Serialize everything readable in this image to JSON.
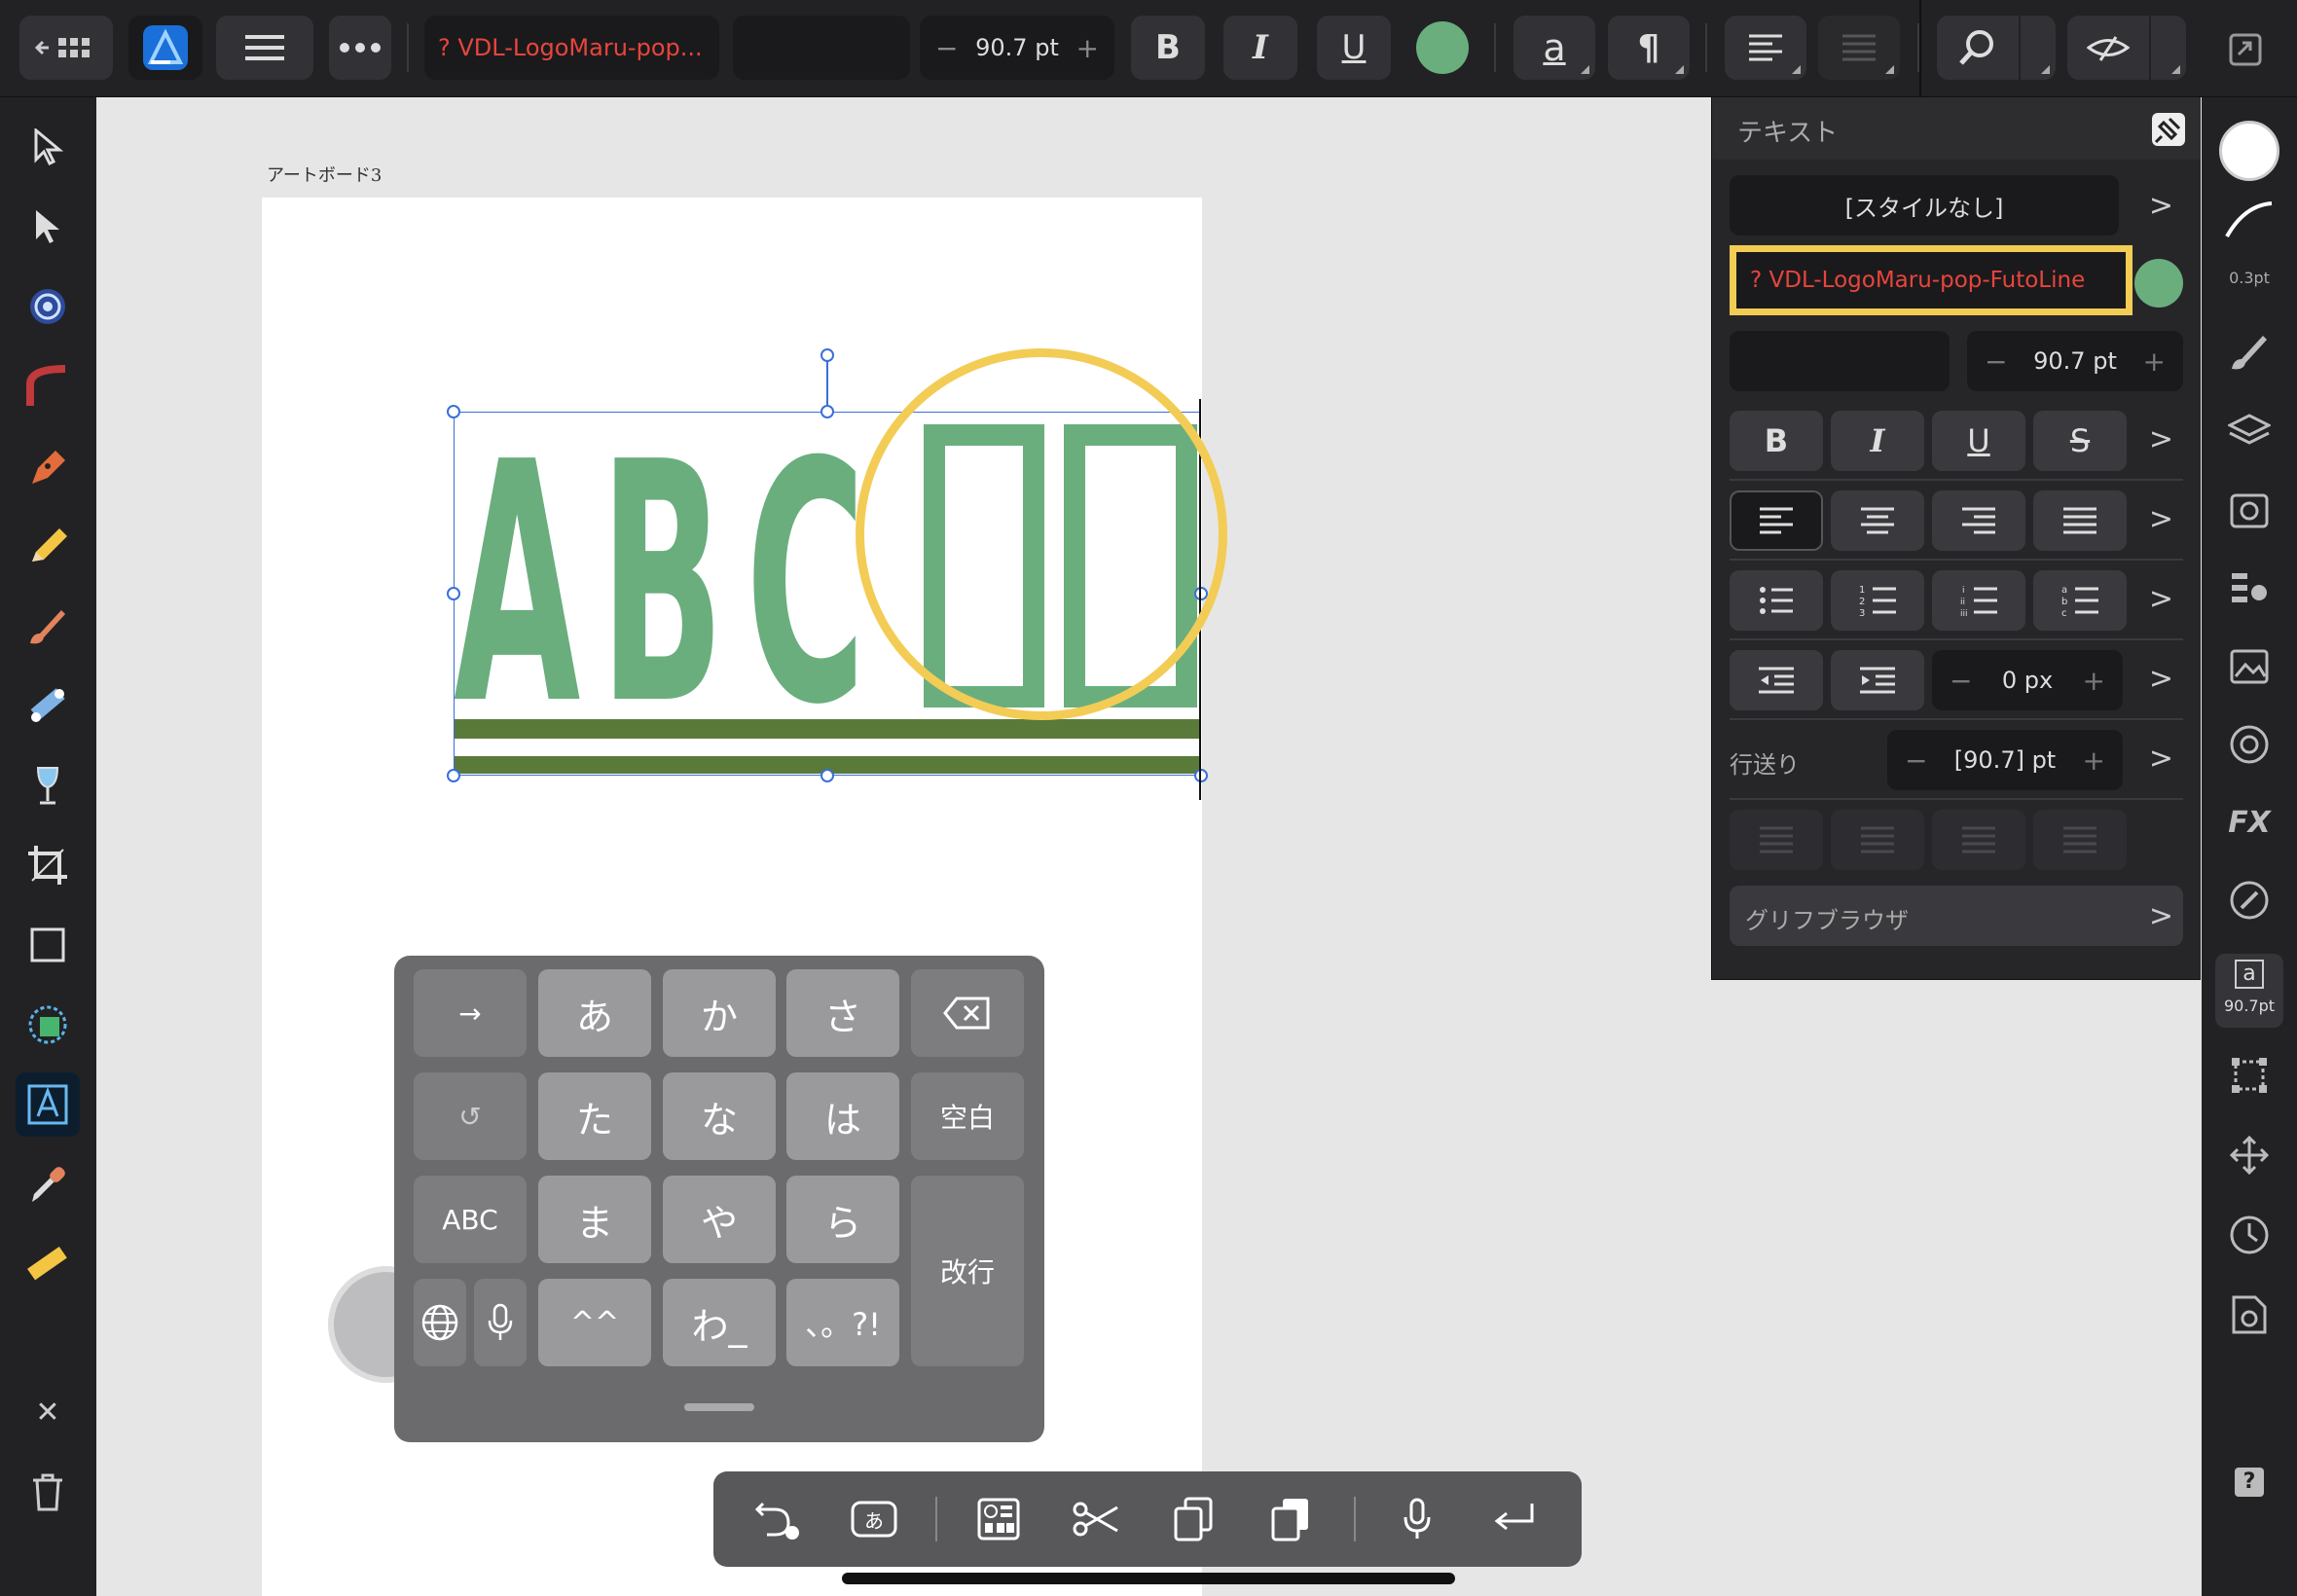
{
  "topbar": {
    "font_name": "? VDL-LogoMaru-pop...",
    "font_size": "90.7 pt",
    "minus": "−",
    "plus": "+",
    "bold": "B",
    "italic": "I",
    "underline": "U",
    "text_style_a": "a",
    "pilcrow": "¶"
  },
  "canvas": {
    "artboard_label": "アートボード3",
    "sample_text": [
      "A",
      "B",
      "C",
      "□",
      "□"
    ],
    "fill_color": "#6aae7e",
    "underline_color": "#5a7a3a",
    "highlight_color": "#f3cc55"
  },
  "panel": {
    "title": "テキスト",
    "style_name": "[スタイルなし]",
    "font_name": "? VDL-LogoMaru-pop-FutoLine",
    "font_color": "#6aae7e",
    "font_size": "90.7 pt",
    "bold": "B",
    "italic": "I",
    "underline": "U",
    "strike": "S",
    "indent_value": "0 px",
    "leading_label": "行送り",
    "leading_value": "[90.7] pt",
    "glyph_browser": "グリフブラウザ",
    "minus": "−",
    "plus": "+",
    "chevron": ">"
  },
  "studiobar": {
    "stroke_width": "0.3pt",
    "text_size": "90.7pt",
    "text_a": "a",
    "help": "?"
  },
  "keyboard": {
    "row1": [
      "→",
      "あ",
      "か",
      "さ"
    ],
    "row2": [
      "↺",
      "た",
      "な",
      "は",
      "空白"
    ],
    "row3": [
      "ABC",
      "ま",
      "や",
      "ら"
    ],
    "row4": [
      "^^",
      "わ_",
      "、。?!"
    ],
    "return": "改行"
  },
  "lefttools": {
    "close": "✕"
  }
}
